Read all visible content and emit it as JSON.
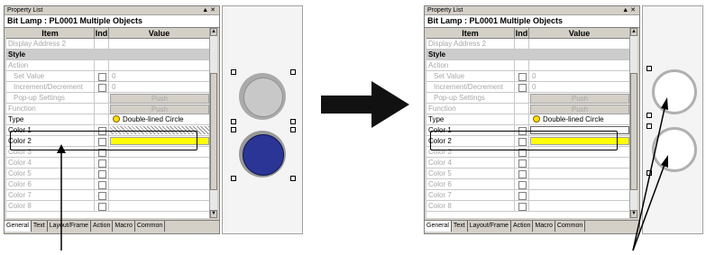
{
  "left_panel": {
    "title": "Property List",
    "title_icons": "▲ ✕",
    "header": "Bit Lamp : PL0001 Multiple Objects",
    "columns": {
      "item": "Item",
      "ind": "Ind",
      "value": "Value"
    },
    "rows": [
      {
        "item": "Display Address 2",
        "value": ""
      },
      {
        "item": "Style",
        "value": ""
      },
      {
        "item": "Action",
        "value": ""
      },
      {
        "item": "Set Value",
        "value": "0"
      },
      {
        "item": "Increment/Decrement",
        "value": "0"
      },
      {
        "item": "Pop-up Settings",
        "value": "Push"
      },
      {
        "item": "Function",
        "value": "Push"
      },
      {
        "item": "Type",
        "value": "Double-lined Circle"
      },
      {
        "item": "Color 1",
        "value": ""
      },
      {
        "item": "Color 2",
        "value": ""
      },
      {
        "item": "Color 3",
        "value": ""
      },
      {
        "item": "Color 4",
        "value": ""
      },
      {
        "item": "Color 5",
        "value": ""
      },
      {
        "item": "Color 6",
        "value": ""
      },
      {
        "item": "Color 7",
        "value": ""
      },
      {
        "item": "Color 8",
        "value": ""
      }
    ],
    "tabs": [
      "General",
      "Text",
      "Layout/Frame",
      "Action",
      "Macro",
      "Common"
    ],
    "scroll_up": "▲",
    "scroll_down": "▼"
  },
  "right_panel": {
    "title": "Property List",
    "title_icons": "▲ ✕",
    "header": "Bit Lamp : PL0001 Multiple Objects",
    "columns": {
      "item": "Item",
      "ind": "Ind",
      "value": "Value"
    },
    "rows": [
      {
        "item": "Display Address 2",
        "value": ""
      },
      {
        "item": "Style",
        "value": ""
      },
      {
        "item": "Action",
        "value": ""
      },
      {
        "item": "Set Value",
        "value": "0"
      },
      {
        "item": "Increment/Decrement",
        "value": "0"
      },
      {
        "item": "Pop-up Settings",
        "value": "Push"
      },
      {
        "item": "Function",
        "value": "Push"
      },
      {
        "item": "Type",
        "value": "Double-lined Circle"
      },
      {
        "item": "Color 1",
        "value": ""
      },
      {
        "item": "Color 2",
        "value": ""
      },
      {
        "item": "Color 3",
        "value": ""
      },
      {
        "item": "Color 4",
        "value": ""
      },
      {
        "item": "Color 5",
        "value": ""
      },
      {
        "item": "Color 6",
        "value": ""
      },
      {
        "item": "Color 7",
        "value": ""
      },
      {
        "item": "Color 8",
        "value": ""
      }
    ],
    "tabs": [
      "General",
      "Text",
      "Layout/Frame",
      "Action",
      "Macro",
      "Common"
    ],
    "scroll_up": "▲",
    "scroll_down": "▼"
  },
  "colors": {
    "lamp_blue": "#2b3596",
    "lamp_grey": "#c8c8c8",
    "color2_yellow": "#ffff00",
    "arrow": "#111111"
  }
}
